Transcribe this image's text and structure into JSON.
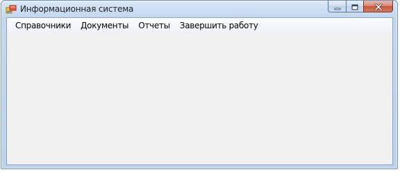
{
  "window": {
    "title": "Информационная система",
    "icon": "app-form-icon",
    "caption_buttons": {
      "minimize": "minimize-icon",
      "maximize": "maximize-icon",
      "close": "close-icon"
    }
  },
  "menu": {
    "items": [
      {
        "label": "Справочники"
      },
      {
        "label": "Документы"
      },
      {
        "label": "Отчеты"
      },
      {
        "label": "Завершить работу"
      }
    ]
  },
  "colors": {
    "frame": "#c3d7ee",
    "client_background": "#f0f0f0",
    "close_button": "#c9553b"
  }
}
